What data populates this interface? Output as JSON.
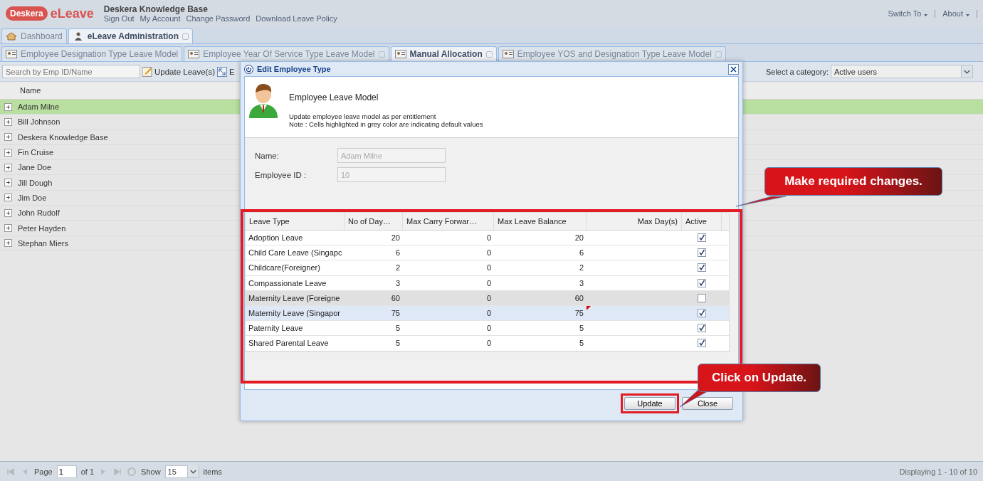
{
  "header": {
    "logo": {
      "brand": "Deskera",
      "product": "eLeave"
    },
    "company": "Deskera Knowledge Base",
    "links": [
      "Sign Out",
      "My Account",
      "Change Password",
      "Download Leave Policy"
    ],
    "menus": [
      "Switch To",
      "About"
    ]
  },
  "main_tabs": [
    {
      "label": "Dashboard",
      "selected": false,
      "closable": false
    },
    {
      "label": "eLeave Administration",
      "selected": true,
      "closable": true
    }
  ],
  "sub_tabs": [
    {
      "label": "Employee Designation Type Leave Model",
      "selected": false,
      "closable": false
    },
    {
      "label": "Employee Year Of Service Type Leave Model",
      "selected": false,
      "closable": true
    },
    {
      "label": "Manual Allocation",
      "selected": true,
      "closable": true
    },
    {
      "label": "Employee YOS and Designation Type Leave Model",
      "selected": false,
      "closable": true
    }
  ],
  "toolbar": {
    "search": {
      "placeholder": "Search by Emp ID/Name"
    },
    "buttons": [
      "Update Leave(s)",
      "E"
    ],
    "category_label": "Select a category:",
    "category_value": "Active users"
  },
  "employees": {
    "column": "Name",
    "rows": [
      {
        "name": "Adam Milne",
        "selected": true
      },
      {
        "name": "Bill Johnson",
        "selected": false
      },
      {
        "name": "Deskera Knowledge Base",
        "selected": false
      },
      {
        "name": "Fin Cruise",
        "selected": false
      },
      {
        "name": "Jane Doe",
        "selected": false
      },
      {
        "name": "Jill Dough",
        "selected": false
      },
      {
        "name": "Jim Doe",
        "selected": false
      },
      {
        "name": "John Rudolf",
        "selected": false
      },
      {
        "name": "Peter Hayden",
        "selected": false
      },
      {
        "name": "Stephan Miers",
        "selected": false
      }
    ]
  },
  "paging": {
    "page_label": "Page",
    "page": "1",
    "of": "of 1",
    "show_label": "Show",
    "page_size": "15",
    "items_label": "items",
    "summary": "Displaying 1 - 10 of 10"
  },
  "dialog": {
    "title": "Edit Employee Type",
    "heading": "Employee Leave Model",
    "description": "Update employee leave model as per entitlement",
    "note": "Note : Cells highlighted in grey color are indicating default values",
    "fields": [
      {
        "label": "Name:",
        "value": "Adam Milne"
      },
      {
        "label": "Employee ID :",
        "value": "10"
      }
    ],
    "columns": [
      "Leave Type",
      "No of Day…",
      "Max Carry Forwar…",
      "Max Leave Balance",
      "Max Day(s)",
      "Active"
    ],
    "rows": [
      {
        "cells": [
          "Adoption Leave",
          "20",
          "0",
          "20",
          ""
        ],
        "active": true,
        "selected": false,
        "modified": false
      },
      {
        "cells": [
          "Child Care Leave (Singapc",
          "6",
          "0",
          "6",
          ""
        ],
        "active": true,
        "selected": false,
        "modified": false
      },
      {
        "cells": [
          "Childcare(Foreigner)",
          "2",
          "0",
          "2",
          ""
        ],
        "active": true,
        "selected": false,
        "modified": false
      },
      {
        "cells": [
          "Compassionate Leave",
          "3",
          "0",
          "3",
          ""
        ],
        "active": true,
        "selected": false,
        "modified": false
      },
      {
        "cells": [
          "Maternity Leave (Foreigne",
          "60",
          "0",
          "60",
          ""
        ],
        "active": false,
        "selected": false,
        "modified": false
      },
      {
        "cells": [
          "Maternity Leave (Singapor",
          "75",
          "0",
          "75",
          ""
        ],
        "active": true,
        "selected": true,
        "modified": true
      },
      {
        "cells": [
          "Paternity Leave",
          "5",
          "0",
          "5",
          ""
        ],
        "active": true,
        "selected": false,
        "modified": false
      },
      {
        "cells": [
          "Shared Parental Leave",
          "5",
          "0",
          "5",
          ""
        ],
        "active": true,
        "selected": false,
        "modified": false
      }
    ],
    "buttons": [
      "Update",
      "Close"
    ]
  },
  "annotations": [
    {
      "text": "Make required changes."
    },
    {
      "text": "Click on Update."
    }
  ]
}
